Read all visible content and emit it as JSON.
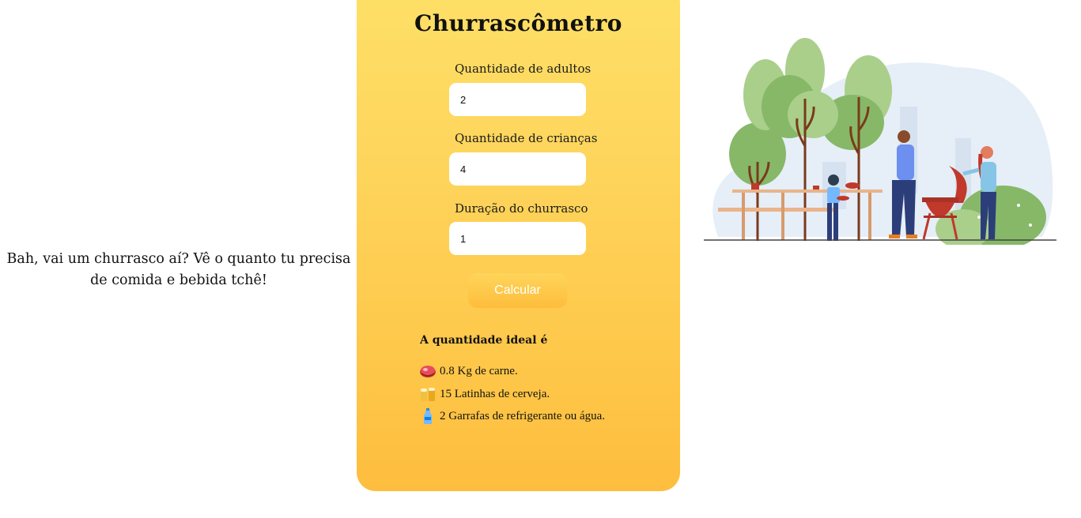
{
  "tagline": "Bah, vai um churrasco aí? Vê o quanto tu precisa de comida e bebida tchê!",
  "form": {
    "title": "Churrascômetro",
    "adults_label": "Quantidade de adultos",
    "adults_value": "2",
    "children_label": "Quantidade de crianças",
    "children_value": "4",
    "duration_label": "Duração do churrasco",
    "duration_value": "1",
    "calculate_label": "Calcular"
  },
  "result": {
    "title": "A quantidade ideal é",
    "items": [
      {
        "icon": "meat-icon",
        "text": "0.8 Kg de carne."
      },
      {
        "icon": "beer-icon",
        "text": "15 Latinhas de cerveja."
      },
      {
        "icon": "bottle-icon",
        "text": "2 Garrafas de refrigerante ou água."
      }
    ]
  },
  "colors": {
    "card_top": "#fee067",
    "card_bottom": "#febd3e",
    "button_text": "#ffffff"
  }
}
